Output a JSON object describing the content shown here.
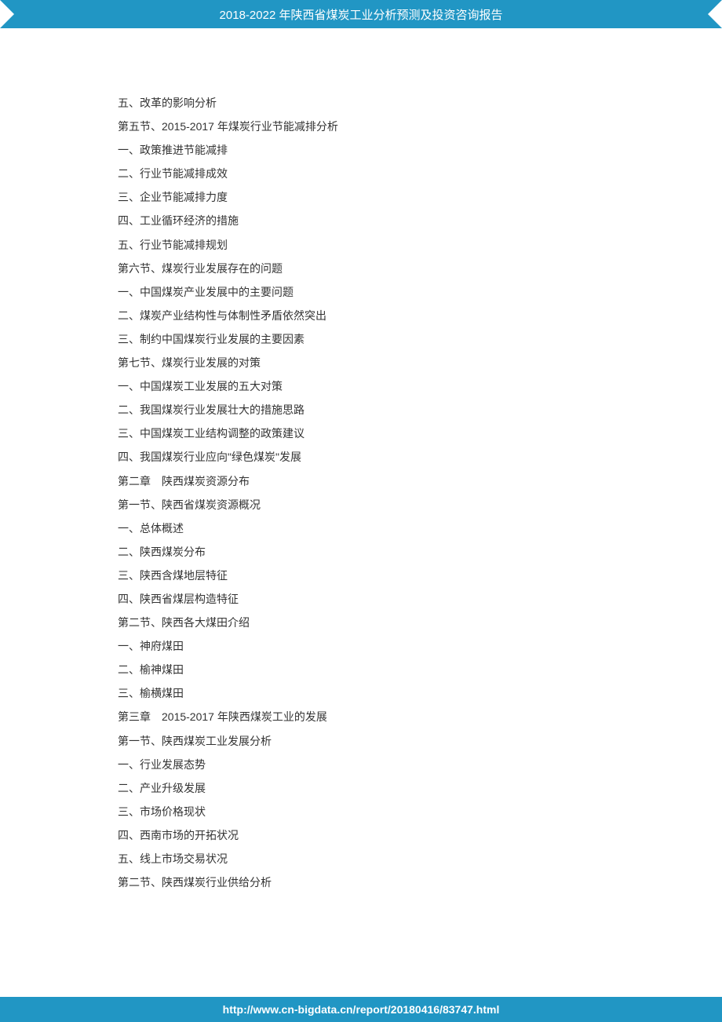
{
  "header": {
    "title": "2018-2022 年陕西省煤炭工业分析预测及投资咨询报告"
  },
  "toc": {
    "lines": [
      "五、改革的影响分析",
      "第五节、2015-2017 年煤炭行业节能减排分析",
      "一、政策推进节能减排",
      "二、行业节能减排成效",
      "三、企业节能减排力度",
      "四、工业循环经济的措施",
      "五、行业节能减排规划",
      "第六节、煤炭行业发展存在的问题",
      "一、中国煤炭产业发展中的主要问题",
      "二、煤炭产业结构性与体制性矛盾依然突出",
      "三、制约中国煤炭行业发展的主要因素",
      "第七节、煤炭行业发展的对策",
      "一、中国煤炭工业发展的五大对策",
      "二、我国煤炭行业发展壮大的措施思路",
      "三、中国煤炭工业结构调整的政策建议",
      "四、我国煤炭行业应向\"绿色煤炭\"发展",
      "第二章　陕西煤炭资源分布",
      "第一节、陕西省煤炭资源概况",
      "一、总体概述",
      "二、陕西煤炭分布",
      "三、陕西含煤地层特征",
      "四、陕西省煤层构造特征",
      "第二节、陕西各大煤田介绍",
      "一、神府煤田",
      "二、榆神煤田",
      "三、榆横煤田",
      "第三章　2015-2017 年陕西煤炭工业的发展",
      "第一节、陕西煤炭工业发展分析",
      "一、行业发展态势",
      "二、产业升级发展",
      "三、市场价格现状",
      "四、西南市场的开拓状况",
      "五、线上市场交易状况",
      "第二节、陕西煤炭行业供给分析"
    ]
  },
  "footer": {
    "url": "http://www.cn-bigdata.cn/report/20180416/83747.html"
  }
}
